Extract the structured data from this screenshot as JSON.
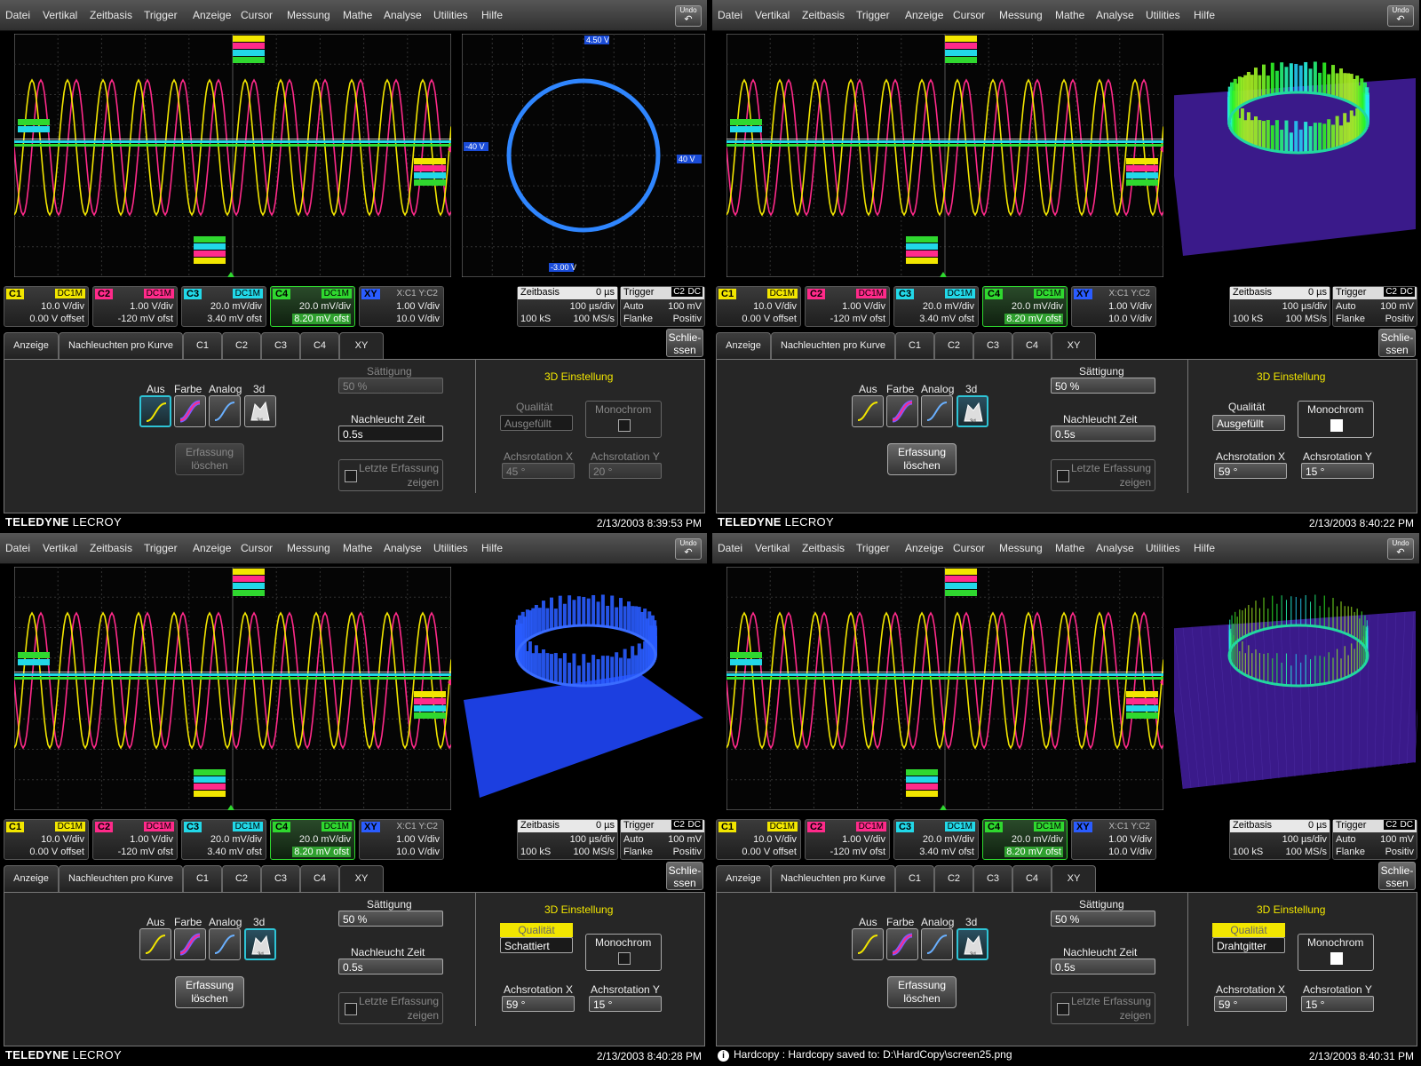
{
  "menu": [
    "Datei",
    "Vertikal",
    "Zeitbasis",
    "Trigger",
    "Anzeige",
    "Cursor",
    "Messung",
    "Mathe",
    "Analyse",
    "Utilities",
    "Hilfe"
  ],
  "undo_label": "Undo",
  "channels": [
    {
      "name": "C1",
      "coupling": "DC1M",
      "line1": "10.0 V/div",
      "line2": "0.00 V offset",
      "color": "#f2e600"
    },
    {
      "name": "C2",
      "coupling": "DC1M",
      "line1": "1.00 V/div",
      "line2": "-120 mV ofst",
      "color": "#ff2a8a"
    },
    {
      "name": "C3",
      "coupling": "DC1M",
      "line1": "20.0 mV/div",
      "line2": "3.40 mV ofst",
      "color": "#22d8e8"
    },
    {
      "name": "C4",
      "coupling": "DC1M",
      "line1": "20.0 mV/div",
      "line2": "8.20 mV ofst",
      "color": "#2fd82f"
    },
    {
      "name": "XY",
      "coupling": "X:C1 Y:C2",
      "line1": "1.00 V/div",
      "line2": "10.0 V/div",
      "color": "#2a5cff"
    }
  ],
  "timebase": {
    "label": "Zeitbasis",
    "delay": "0 µs",
    "per_div": "100 µs/div",
    "samples": "100 kS",
    "rate": "100 MS/s"
  },
  "trigger": {
    "label": "Trigger",
    "channel": "C2",
    "coupling": "DC",
    "mode": "Auto",
    "level": "100 mV",
    "type": "Flanke",
    "slope": "Positiv"
  },
  "tabs": [
    "Anzeige",
    "Nachleuchten pro Kurve",
    "C1",
    "C2",
    "C3",
    "C4",
    "XY"
  ],
  "close_label": "Schlie- ssen",
  "labels": {
    "aus": "Aus",
    "farbe": "Farbe",
    "analog": "Analog",
    "d3": "3d",
    "saettigung": "Sättigung",
    "nachleucht": "Nachleucht Zeit",
    "erfassung1": "Erfassung",
    "erfassung2": "löschen",
    "letzte1": "Letzte Erfassung",
    "letzte2": "zeigen",
    "einstellung": "3D Einstellung",
    "qualitaet": "Qualität",
    "monochrom": "Monochrom",
    "rotx": "Achsrotation X",
    "roty": "Achsrotation Y"
  },
  "brand": {
    "bold": "TELEDYNE",
    "normal": "LECROY"
  },
  "scopes": [
    {
      "mode": "aus",
      "saettigung": "50 %",
      "nachleucht": "0.5s",
      "qualitaet": "Ausgefüllt",
      "rotx": "45 °",
      "roty": "20 °",
      "date": "2/13/2003 8:39:53 PM",
      "footer_msg": "",
      "dim": true,
      "qual_highlight": false,
      "mono_white": false,
      "side": "xy-circle",
      "xy_labels": {
        "top": "4.50 V",
        "left": "-40 V",
        "right": "40 V",
        "bottom": "-3.00 V"
      }
    },
    {
      "mode": "3d",
      "saettigung": "50 %",
      "nachleucht": "0.5s",
      "qualitaet": "Ausgefüllt",
      "rotx": "59 °",
      "roty": "15 °",
      "date": "2/13/2003 8:40:22 PM",
      "footer_msg": "",
      "dim": false,
      "qual_highlight": false,
      "mono_white": true,
      "side": "3d-color"
    },
    {
      "mode": "3d",
      "saettigung": "50 %",
      "nachleucht": "0.5s",
      "qualitaet": "Schattiert",
      "rotx": "59 °",
      "roty": "15 °",
      "date": "2/13/2003 8:40:28 PM",
      "footer_msg": "",
      "dim": false,
      "qual_highlight": true,
      "mono_white": false,
      "side": "3d-shaded"
    },
    {
      "mode": "3d",
      "saettigung": "50 %",
      "nachleucht": "0.5s",
      "qualitaet": "Drahtgitter",
      "rotx": "59 °",
      "roty": "15 °",
      "date": "2/13/2003 8:40:31 PM",
      "footer_msg": "Hardcopy : Hardcopy saved to: D:\\HardCopy\\screen25.png",
      "dim": false,
      "qual_highlight": true,
      "mono_white": true,
      "side": "3d-wire"
    }
  ],
  "colors": {
    "c1": "#f2e600",
    "c2": "#ff2a8a",
    "c3": "#22d8e8",
    "c4": "#2fd82f",
    "xy": "#2a5cff"
  }
}
